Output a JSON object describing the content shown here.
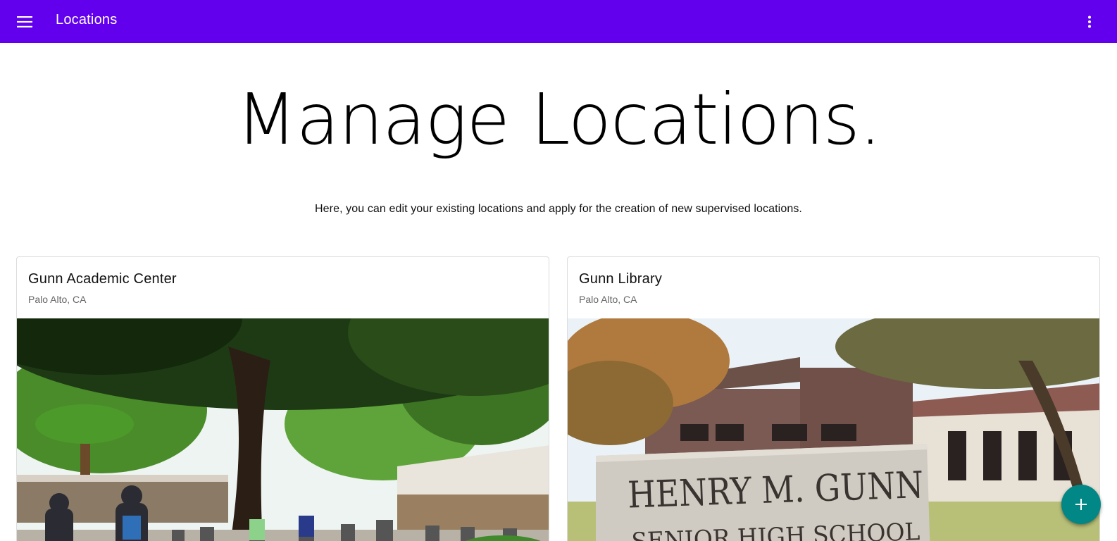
{
  "appbar": {
    "title": "Locations",
    "menu_icon": "menu-icon",
    "more_icon": "more-vert-icon",
    "color": "#6200ee"
  },
  "hero": {
    "title": "Manage Locations.",
    "subtitle": "Here, you can edit your existing locations and apply for the creation of new supervised locations."
  },
  "locations": [
    {
      "name": "Gunn Academic Center",
      "place": "Palo Alto, CA"
    },
    {
      "name": "Gunn Library",
      "place": "Palo Alto, CA",
      "sign_line1": "HENRY M. GUNN",
      "sign_line2": "SENIOR HIGH SCHOOL"
    }
  ],
  "fab": {
    "icon": "add-icon",
    "color": "#018786"
  }
}
